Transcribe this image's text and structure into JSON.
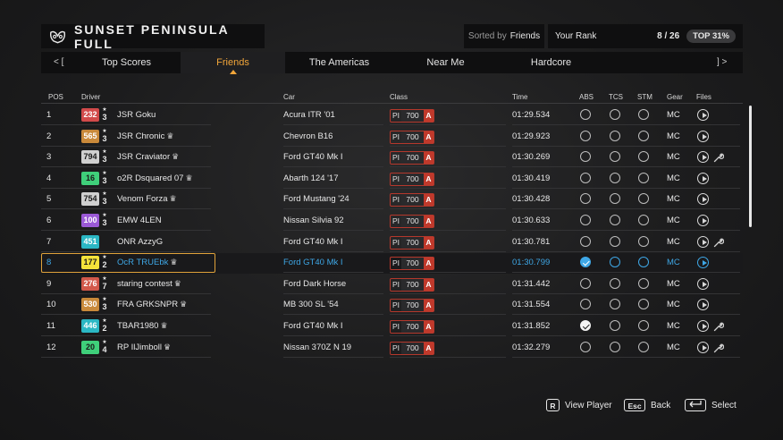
{
  "header": {
    "title": "SUNSET PENINSULA FULL",
    "sort_label": "Sorted by",
    "sort_value": "Friends",
    "rank_label": "Your Rank",
    "rank_value": "8 / 26",
    "rank_badge": "TOP 31%"
  },
  "tabs": {
    "prev_glyph": "< [",
    "next_glyph": "] >",
    "items": [
      {
        "label": "Top Scores"
      },
      {
        "label": "Friends",
        "active": true
      },
      {
        "label": "The Americas"
      },
      {
        "label": "Near Me"
      },
      {
        "label": "Hardcore"
      }
    ]
  },
  "columns": {
    "pos": "POS",
    "driver": "Driver",
    "car": "Car",
    "class": "Class",
    "time": "Time",
    "abs": "ABS",
    "tcs": "TCS",
    "stm": "STM",
    "gear": "Gear",
    "files": "Files"
  },
  "colors": {
    "accent": "#f2a63a",
    "highlight": "#3ea7e6",
    "class_a": "#c0392b"
  },
  "rows": [
    {
      "pos": "1",
      "level": "232",
      "level_color": "#d24a4a",
      "stars": "3",
      "driver": "JSR Goku",
      "crown": false,
      "car": "Acura ITR '01",
      "pi": "PI",
      "pi_value": "700",
      "class": "A",
      "time": "01:29.534",
      "abs": false,
      "tcs": false,
      "stm": false,
      "gear": "MC",
      "tune": false
    },
    {
      "pos": "2",
      "level": "565",
      "level_color": "#c9893a",
      "stars": "3",
      "driver": "JSR Chronic",
      "crown": true,
      "car": "Chevron B16",
      "pi": "PI",
      "pi_value": "700",
      "class": "A",
      "time": "01:29.923",
      "abs": false,
      "tcs": false,
      "stm": false,
      "gear": "MC",
      "tune": false
    },
    {
      "pos": "3",
      "level": "794",
      "level_color": "#d0d0d0",
      "stars": "3",
      "driver": "JSR Craviator",
      "crown": true,
      "car": "Ford GT40 Mk I",
      "pi": "PI",
      "pi_value": "700",
      "class": "A",
      "time": "01:30.269",
      "abs": false,
      "tcs": false,
      "stm": false,
      "gear": "MC",
      "tune": true
    },
    {
      "pos": "4",
      "level": "16",
      "level_color": "#3fcf7a",
      "stars": "3",
      "driver": "o2R Dsquared 07",
      "crown": true,
      "car": "Abarth 124 '17",
      "pi": "PI",
      "pi_value": "700",
      "class": "A",
      "time": "01:30.419",
      "abs": false,
      "tcs": false,
      "stm": false,
      "gear": "MC",
      "tune": false
    },
    {
      "pos": "5",
      "level": "754",
      "level_color": "#d0d0d0",
      "stars": "3",
      "driver": "Venom Forza",
      "crown": true,
      "car": "Ford Mustang '24",
      "pi": "PI",
      "pi_value": "700",
      "class": "A",
      "time": "01:30.428",
      "abs": false,
      "tcs": false,
      "stm": false,
      "gear": "MC",
      "tune": false
    },
    {
      "pos": "6",
      "level": "100",
      "level_color": "#9b59d6",
      "stars": "3",
      "driver": "EMW 4LEN",
      "crown": false,
      "car": "Nissan Silvia 92",
      "pi": "PI",
      "pi_value": "700",
      "class": "A",
      "time": "01:30.633",
      "abs": false,
      "tcs": false,
      "stm": false,
      "gear": "MC",
      "tune": false
    },
    {
      "pos": "7",
      "level": "451",
      "level_color": "#2bb7c4",
      "stars": "",
      "driver": "ONR AzzyG",
      "crown": false,
      "car": "Ford GT40 Mk I",
      "pi": "PI",
      "pi_value": "700",
      "class": "A",
      "time": "01:30.781",
      "abs": false,
      "tcs": false,
      "stm": false,
      "gear": "MC",
      "tune": true
    },
    {
      "pos": "8",
      "level": "177",
      "level_color": "#f4e23a",
      "stars": "2",
      "driver": "OcR TRUEbk",
      "crown": true,
      "car": "Ford GT40 Mk I",
      "pi": "PI",
      "pi_value": "700",
      "class": "A",
      "time": "01:30.799",
      "abs": true,
      "tcs": false,
      "stm": false,
      "gear": "MC",
      "tune": false,
      "highlight": true
    },
    {
      "pos": "9",
      "level": "276",
      "level_color": "#d2584a",
      "stars": "7",
      "driver": "staring contest",
      "crown": true,
      "car": "Ford Dark Horse",
      "pi": "PI",
      "pi_value": "700",
      "class": "A",
      "time": "01:31.442",
      "abs": false,
      "tcs": false,
      "stm": false,
      "gear": "MC",
      "tune": false
    },
    {
      "pos": "10",
      "level": "530",
      "level_color": "#c9893a",
      "stars": "3",
      "driver": "FRA GRKSNPR",
      "crown": true,
      "car": "MB 300 SL '54",
      "pi": "PI",
      "pi_value": "700",
      "class": "A",
      "time": "01:31.554",
      "abs": false,
      "tcs": false,
      "stm": false,
      "gear": "MC",
      "tune": false
    },
    {
      "pos": "11",
      "level": "446",
      "level_color": "#2bb7c4",
      "stars": "2",
      "driver": "TBAR1980",
      "crown": true,
      "car": "Ford GT40 Mk I",
      "pi": "PI",
      "pi_value": "700",
      "class": "A",
      "time": "01:31.852",
      "abs": true,
      "tcs": false,
      "stm": false,
      "gear": "MC",
      "tune": true
    },
    {
      "pos": "12",
      "level": "20",
      "level_color": "#3fcf7a",
      "stars": "4",
      "driver": "RP IlJimboll",
      "crown": true,
      "car": "Nissan 370Z N 19",
      "pi": "PI",
      "pi_value": "700",
      "class": "A",
      "time": "01:32.279",
      "abs": false,
      "tcs": false,
      "stm": false,
      "gear": "MC",
      "tune": true
    }
  ],
  "footer": {
    "view_key": "R",
    "view_label": "View Player",
    "back_key": "Esc",
    "back_label": "Back",
    "select_label": "Select"
  }
}
